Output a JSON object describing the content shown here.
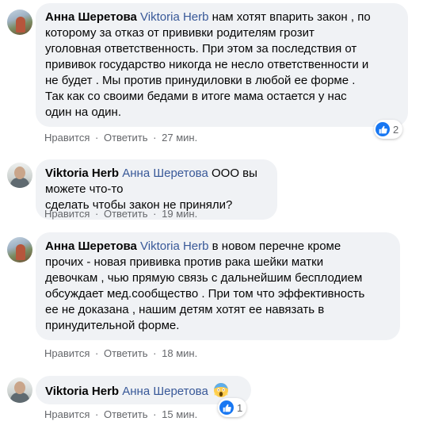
{
  "comments": [
    {
      "author": "Анна Шеретова",
      "mention": "Viktoria Herb",
      "text_lines": [
        " нам хотят впарить закон , по",
        "которому за отказ от прививки родителям грозит",
        "уголовная ответственность. При этом за последствия от",
        "прививок государство никогда не несло ответственности и",
        "не будет . Мы против принудиловки в любой ее форме .",
        "Так как со своими бедами в итоге мама остается у нас",
        "один на один."
      ],
      "like_label": "Нравится",
      "reply_label": "Ответить",
      "time": "27 мин.",
      "reaction_count": "2"
    },
    {
      "author": "Viktoria Herb",
      "mention": "Анна Шеретова",
      "text_lines": [
        " ООО вы можете что-то",
        "сделать чтобы закон не приняли?"
      ],
      "like_label": "Нравится",
      "reply_label": "Ответить",
      "time": "19 мин."
    },
    {
      "author": "Анна Шеретова",
      "mention": "Viktoria Herb",
      "text_lines": [
        " в новом перечне кроме",
        "прочих - новая прививка против рака шейки матки",
        "девочкам , чью прямую связь с дальнейшим бесплодием",
        "обсуждает мед.сообщество . При том что эффективность",
        "ее не доказана , нашим детям хотят ее навязать в",
        "принудительной форме."
      ],
      "like_label": "Нравится",
      "reply_label": "Ответить",
      "time": "18 мин."
    },
    {
      "author": "Viktoria Herb",
      "mention": "Анна Шеретова",
      "emoji": "screaming-face-emoji",
      "like_label": "Нравится",
      "reply_label": "Ответить",
      "time": "15 мин.",
      "reaction_count": "1"
    }
  ],
  "separator": "·",
  "colors": {
    "bubble_bg": "#f0f2f5",
    "mention": "#385898",
    "meta": "#65676b",
    "like_blue": "#1877f2"
  }
}
